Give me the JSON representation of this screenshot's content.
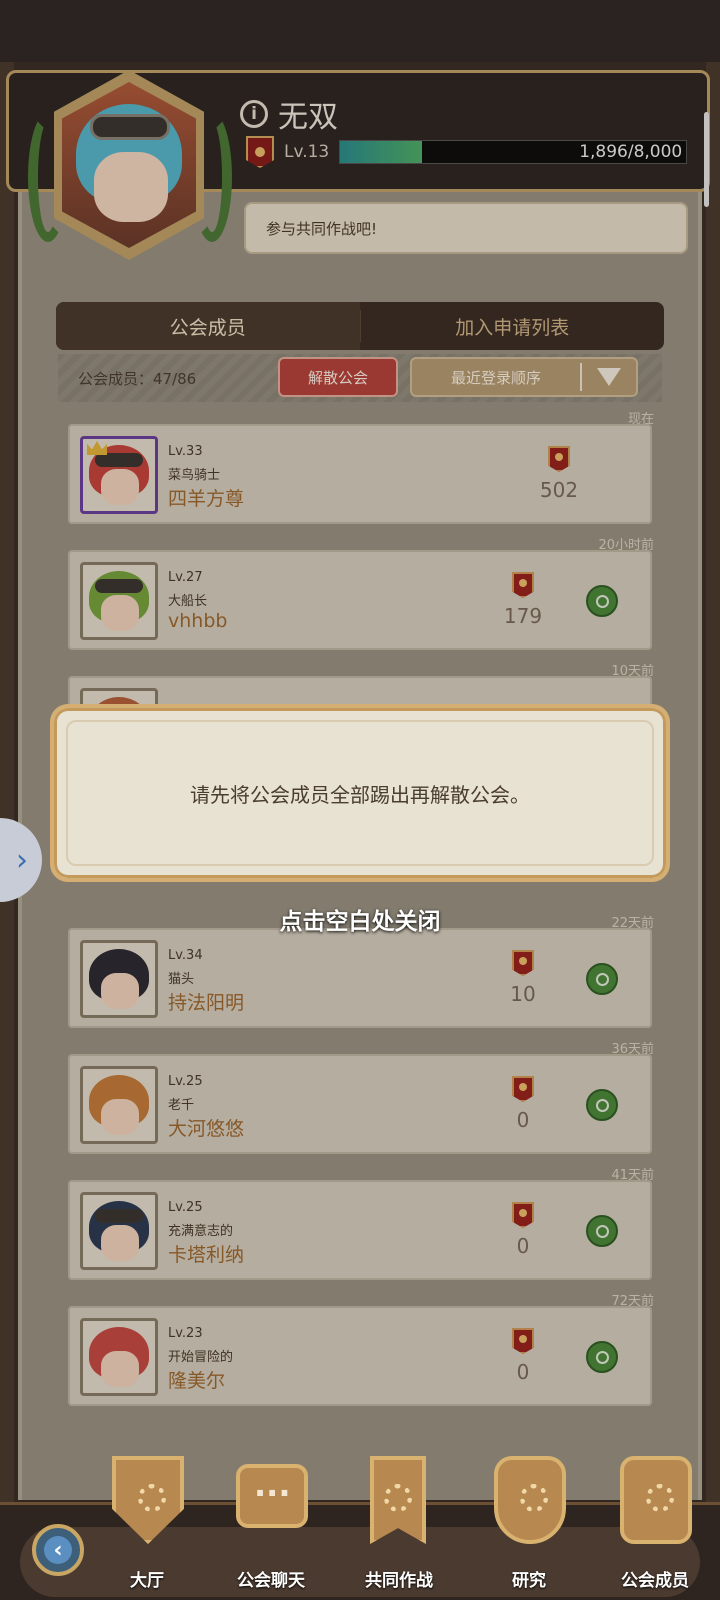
{
  "header": {
    "player_name": "无双",
    "level": "Lv.13",
    "xp_text": "1,896/8,000",
    "xp_progress": 0.237,
    "message": "参与共同作战吧!"
  },
  "tabs": [
    {
      "label": "公会成员",
      "active": true
    },
    {
      "label": "加入申请列表",
      "active": false
    }
  ],
  "toolbar": {
    "member_count": "公会成员：47/86",
    "disband_label": "解散公会",
    "sort_label": "最近登录顺序"
  },
  "members": [
    {
      "time": "现在",
      "level": "Lv.33",
      "title": "菜鸟骑士",
      "name": "四羊方尊",
      "contribution": "502",
      "leader": true
    },
    {
      "time": "20小时前",
      "level": "Lv.27",
      "title": "大船长",
      "name": "vhhbb",
      "contribution": "179",
      "leader": false
    },
    {
      "time": "10天前",
      "level": "",
      "title": "",
      "name": "",
      "contribution": "",
      "leader": false
    },
    {
      "time": "22天前",
      "level": "Lv.34",
      "title": "猫头",
      "name": "持法阳明",
      "contribution": "10",
      "leader": false
    },
    {
      "time": "36天前",
      "level": "Lv.25",
      "title": "老千",
      "name": "大河悠悠",
      "contribution": "0",
      "leader": false
    },
    {
      "time": "41天前",
      "level": "Lv.25",
      "title": "充满意志的",
      "name": "卡塔利纳",
      "contribution": "0",
      "leader": false
    },
    {
      "time": "72天前",
      "level": "Lv.23",
      "title": "开始冒险的",
      "name": "隆美尔",
      "contribution": "0",
      "leader": false
    }
  ],
  "popup": {
    "message": "请先将公会成员全部踢出再解散公会。",
    "close_hint": "点击空白处关闭"
  },
  "bottom_nav": [
    {
      "label": "大厅",
      "icon": "hall-shield-icon"
    },
    {
      "label": "公会聊天",
      "icon": "chat-bubble-icon"
    },
    {
      "label": "共同作战",
      "icon": "banner-gear-icon"
    },
    {
      "label": "研究",
      "icon": "flask-icon"
    },
    {
      "label": "公会成员",
      "icon": "guild-members-icon"
    }
  ],
  "colors": {
    "panel": "#9a9384",
    "card": "#d8d0c0",
    "name_gold": "#a06a30",
    "disband_red": "#b8433a",
    "search_green": "#4c8a3a"
  }
}
